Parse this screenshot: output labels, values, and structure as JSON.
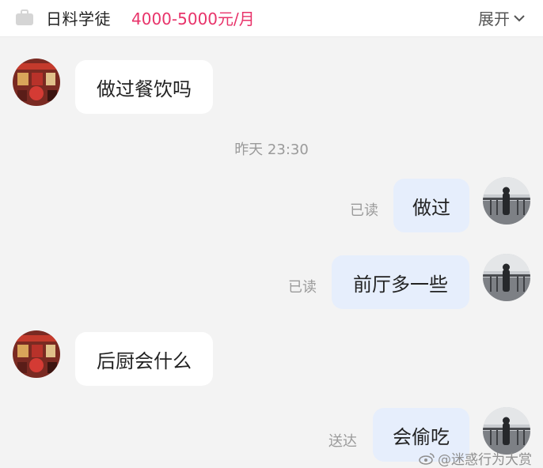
{
  "header": {
    "job_title": "日料学徒",
    "salary": "4000-5000元/月",
    "expand_label": "展开",
    "salary_color": "#e8336a"
  },
  "timestamp": "昨天 23:30",
  "messages": [
    {
      "side": "in",
      "text": "做过餐饮吗"
    },
    {
      "side": "out",
      "text": "做过",
      "receipt": "已读"
    },
    {
      "side": "out",
      "text": "前厅多一些",
      "receipt": "已读"
    },
    {
      "side": "in",
      "text": "后厨会什么"
    },
    {
      "side": "out",
      "text": "会偷吃",
      "receipt": "送达"
    }
  ],
  "watermark": "@迷惑行为大赏",
  "colors": {
    "incoming_bubble": "#ffffff",
    "outgoing_bubble": "#e6eefc",
    "background": "#f3f3f3"
  }
}
